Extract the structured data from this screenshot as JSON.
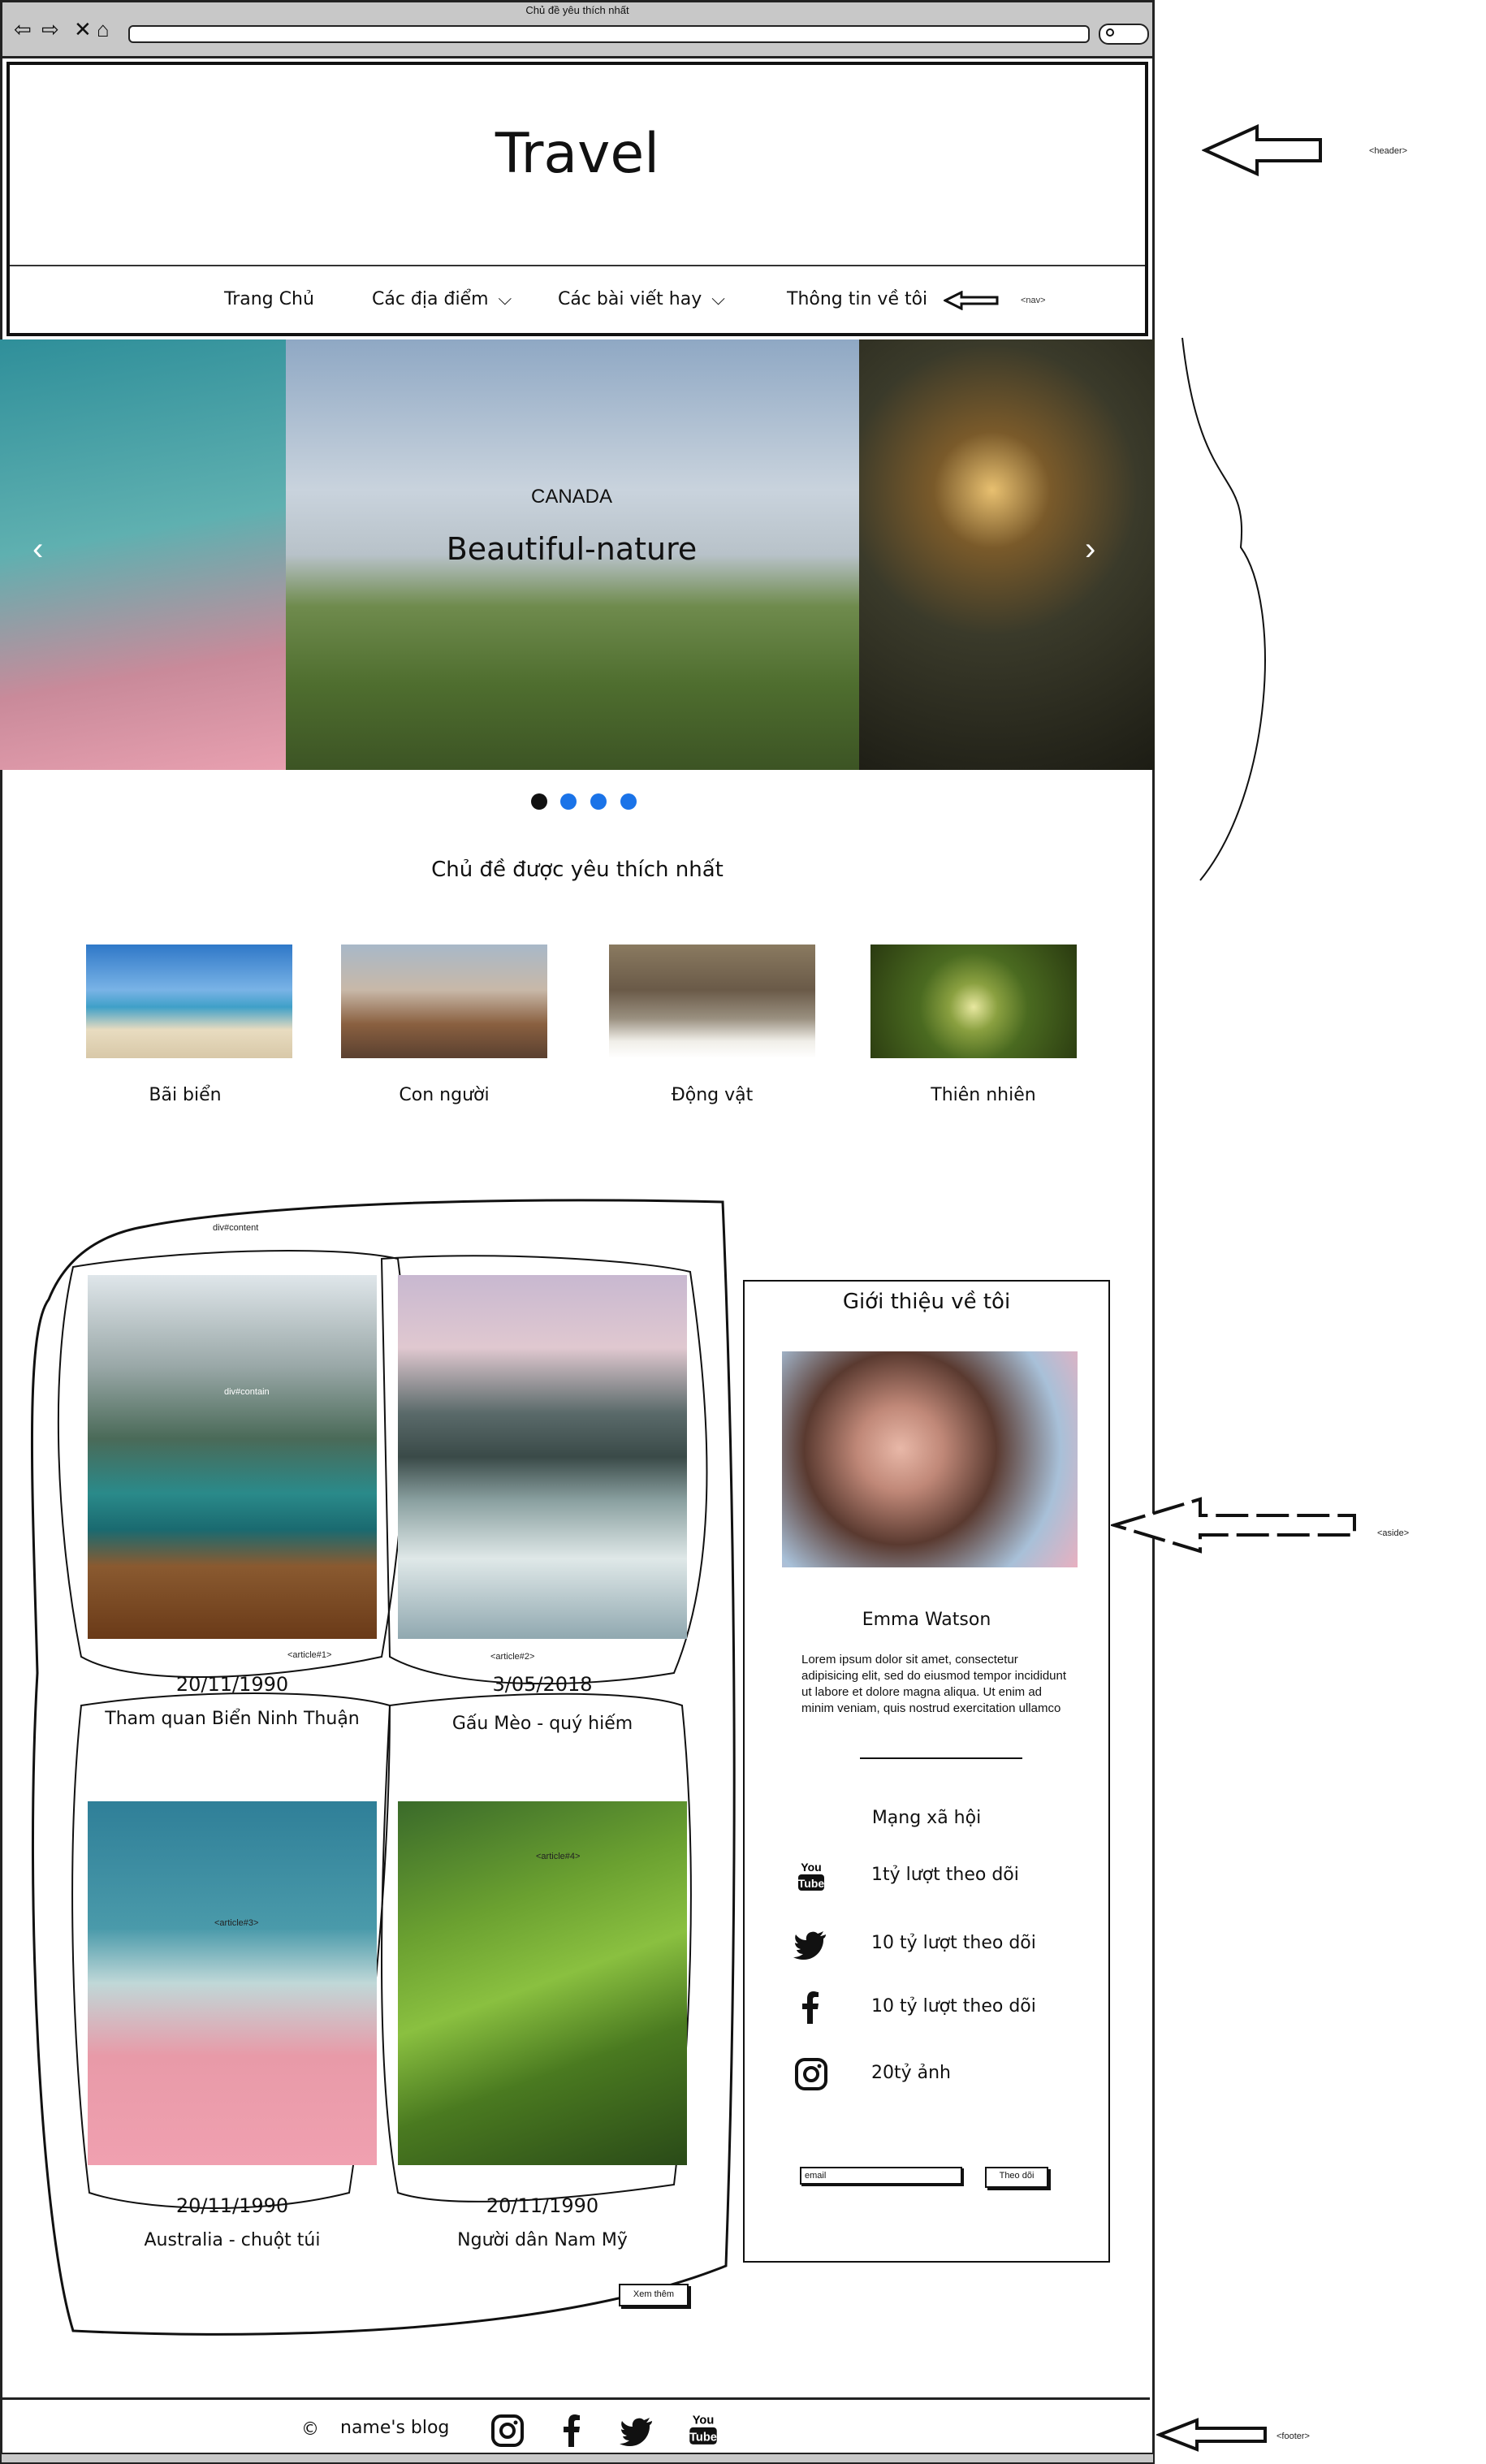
{
  "browser": {
    "tab_title": "Chủ đề yêu thích nhất"
  },
  "header": {
    "site_title": "Travel",
    "note_header": "<header>",
    "note_nav": "<nav>"
  },
  "nav": {
    "items": [
      "Trang Chủ",
      "Các địa điểm",
      "Các bài viết hay",
      "Thông tin về tôi"
    ]
  },
  "hero": {
    "country": "CANADA",
    "caption": "Beautiful-nature",
    "prev_icon": "chevron-left-icon",
    "next_icon": "chevron-right-icon",
    "active_dot": 0,
    "dot_count": 4
  },
  "favorites": {
    "title": "Chủ đề được yêu thích nhất",
    "topics": [
      "Bãi biển",
      "Con người",
      "Động vật",
      "Thiên nhiên"
    ]
  },
  "content": {
    "label_content": "div#content",
    "label_contain": "div#contain",
    "articles": [
      {
        "tag": "<article#1>",
        "date": "20/11/1990",
        "title": "Tham quan Biển Ninh Thuận"
      },
      {
        "tag": "<article#2>",
        "date": "3/05/2018",
        "title": "Gấu Mèo - quý hiếm"
      },
      {
        "tag": "<article#3>",
        "date": "20/11/1990",
        "title": "Australia - chuột túi"
      },
      {
        "tag": "<article#4>",
        "date": "20/11/1990",
        "title": "Người dân Nam Mỹ"
      }
    ],
    "more_button": "Xem thêm"
  },
  "aside": {
    "title": "Giới thiệu về tôi",
    "name": "Emma Watson",
    "bio": "Lorem ipsum dolor sit amet, consectetur adipisicing elit, sed do eiusmod tempor incididunt ut labore et dolore magna aliqua. Ut enim ad minim veniam, quis nostrud exercitation ullamco",
    "social_title": "Mạng xã hội",
    "social": [
      {
        "icon": "youtube-icon",
        "text": "1tỷ lượt theo dõi"
      },
      {
        "icon": "twitter-icon",
        "text": "10 tỷ lượt theo dõi"
      },
      {
        "icon": "facebook-icon",
        "text": "10 tỷ lượt theo dõi"
      },
      {
        "icon": "instagram-icon",
        "text": "20tỷ ảnh"
      }
    ],
    "email_placeholder": "email",
    "follow_button": "Theo dõi",
    "note": "<aside>"
  },
  "footer": {
    "copyright": "©",
    "blog_name": "name's blog",
    "note": "<footer>"
  },
  "colors": {
    "dot_active": "#111111",
    "dot_inactive": "#1a73e8"
  }
}
